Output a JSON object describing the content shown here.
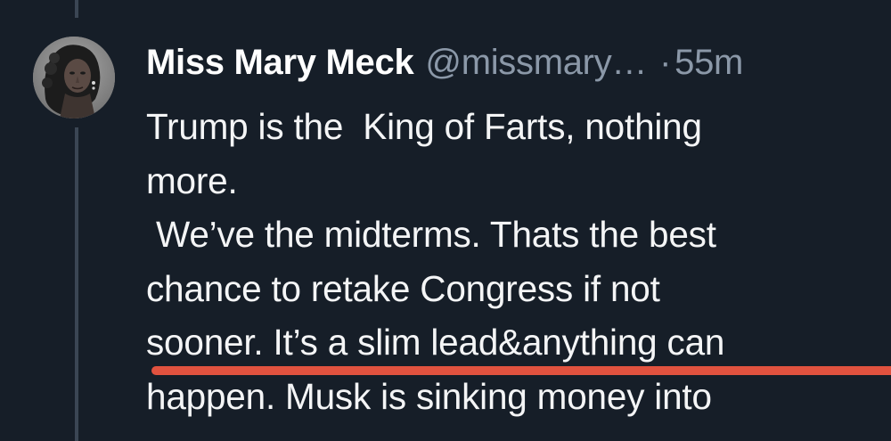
{
  "post": {
    "author": {
      "display_name": "Miss Mary Meck",
      "handle": "@missmary…",
      "avatar_icon": "profile-photo"
    },
    "separator": "·",
    "timestamp": "55m",
    "lines": [
      "Trump is the  King of Farts, nothing",
      "more.",
      " We’ve the midterms. Thats the best",
      "chance to retake Congress if not",
      "sooner. It’s a slim lead&anything can",
      "happen. Musk is sinking money into"
    ],
    "colors": {
      "background": "#161e28",
      "text": "#f4f5f6",
      "secondary_text": "#8b98a8",
      "thread_line": "#3b4654",
      "highlight_underline": "#e1523f"
    }
  }
}
